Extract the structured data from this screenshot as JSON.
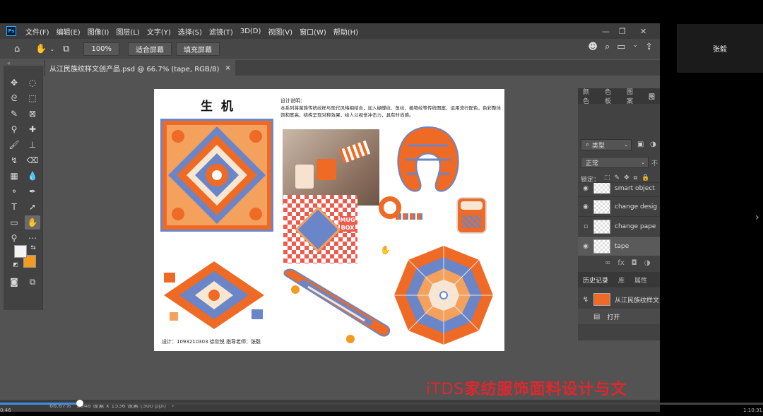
{
  "app": {
    "logo": "Ps",
    "menu": [
      "文件(F)",
      "编辑(E)",
      "图像(I)",
      "图层(L)",
      "文字(Y)",
      "选择(S)",
      "滤镜(T)",
      "3D(D)",
      "视图(V)",
      "窗口(W)",
      "帮助(H)"
    ]
  },
  "options": {
    "zoom": "100%",
    "fit_screen": "适合屏幕",
    "fill_screen": "填充屏幕"
  },
  "document_tab": {
    "label": "从江民族纹样文创产品.psd @ 66.7% (tape, RGB/8)",
    "close": "×"
  },
  "artwork": {
    "title": "生 机",
    "description_heading": "设计说明：",
    "description": "本系列将苗族传统纹样与现代风格相结合，加入蝴蝶纹、鱼纹、植物纹等传统图案，运用流行配色，色彩整体饱和度高，结构呈现对称效果，给人以视觉冲击力，具有时尚感。",
    "credit": "设计：1093210303 徐欣悦      指导老师：张毅",
    "mug_box_text": "MUG BOX"
  },
  "panels": {
    "top_tabs": [
      "颜色",
      "色板",
      "图案",
      "图"
    ],
    "filter_kind": "类型",
    "blend_mode": "正常",
    "opacity_label": "不",
    "lock_label": "锁定：",
    "layers": [
      {
        "name": "smart object",
        "visible": true
      },
      {
        "name": "change desig",
        "visible": true
      },
      {
        "name": "change pape",
        "visible": false
      },
      {
        "name": "tape",
        "visible": true
      }
    ],
    "bottom_tabs": [
      "历史记录",
      "库",
      "属性"
    ],
    "history": [
      {
        "label": "从江民族纹样文"
      },
      {
        "label": "打开"
      }
    ]
  },
  "status": {
    "zoom": "66.67%",
    "size": "2048 像素 x 1536 像素 (300 ppi)",
    "arrow": "›"
  },
  "overlay": {
    "viewer_name": "张毅",
    "watermark_brand": "iTDS",
    "watermark_text": "家纺服饰面料设计与文",
    "time_elapsed": "0:46",
    "time_total": "1:10:31",
    "progress": 0.105
  },
  "colors": {
    "accent_orange": "#f49a1f",
    "pattern_orange": "#ee6a25",
    "pattern_blue": "#6a86c8",
    "watermark_red": "#e2262c"
  }
}
